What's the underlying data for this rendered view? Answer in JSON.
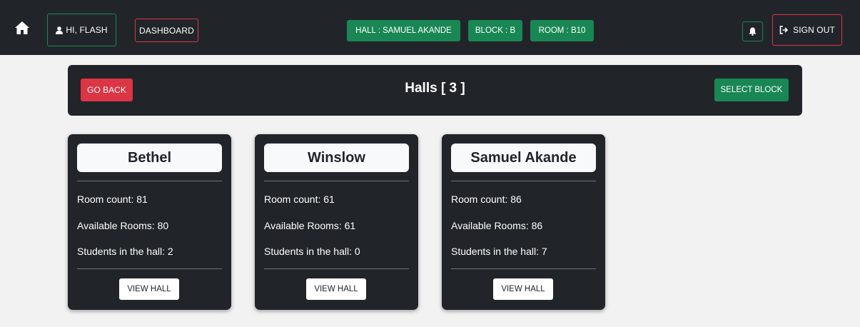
{
  "navbar": {
    "greeting": "HI, FLASH",
    "dashboard_label": "DASHBOARD",
    "hall_pill": "HALL : SAMUEL AKANDE",
    "block_pill": "BLOCK : B",
    "room_pill": "ROOM : B10",
    "signout_label": "SIGN OUT",
    "icons": [
      "home-icon",
      "user-icon",
      "bell-icon",
      "sign-out-icon"
    ]
  },
  "header": {
    "go_back_label": "GO BACK",
    "title": "Halls [ 3 ]",
    "select_block_label": "SELECT BLOCK"
  },
  "halls": [
    {
      "name": "Bethel",
      "room_count": "Room count: 81",
      "available_rooms": "Available Rooms: 80",
      "students": "Students in the hall: 2",
      "button_label": "VIEW HALL"
    },
    {
      "name": "Winslow",
      "room_count": "Room count: 61",
      "available_rooms": "Available Rooms: 61",
      "students": "Students in the hall: 0",
      "button_label": "VIEW HALL"
    },
    {
      "name": "Samuel Akande",
      "room_count": "Room count: 86",
      "available_rooms": "Available Rooms: 86",
      "students": "Students in the hall: 7",
      "button_label": "VIEW HALL"
    }
  ],
  "colors": {
    "dark": "#212529",
    "success": "#198754",
    "danger": "#dc3545",
    "light": "#f8f9fa",
    "page_bg": "#f2f2f2"
  }
}
